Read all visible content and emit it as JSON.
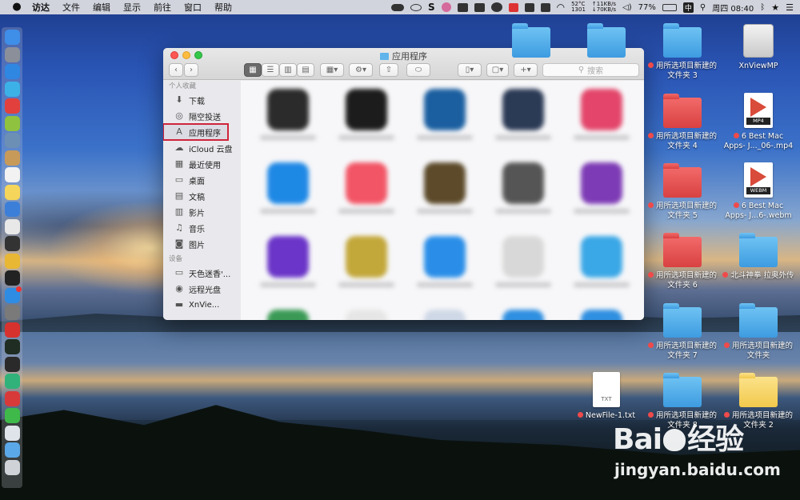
{
  "menubar": {
    "app_name": "访达",
    "items": [
      "文件",
      "编辑",
      "显示",
      "前往",
      "窗口",
      "帮助"
    ],
    "temperature": "52°C",
    "fan": "1301",
    "net_up": "↑11KB/s",
    "net_down": "↓70KB/s",
    "battery": "77%",
    "input_method": "中",
    "clock": "周四 08:40"
  },
  "finder": {
    "title": "应用程序",
    "search_placeholder": "搜索",
    "sidebar": {
      "favorites_header": "个人收藏",
      "favorites": [
        {
          "label": "下载",
          "icon": "download-icon",
          "glyph": "⬇"
        },
        {
          "label": "隔空投送",
          "icon": "airdrop-icon",
          "glyph": "◎"
        },
        {
          "label": "应用程序",
          "icon": "applications-icon",
          "glyph": "A"
        },
        {
          "label": "iCloud 云盘",
          "icon": "cloud-icon",
          "glyph": "☁"
        },
        {
          "label": "最近使用",
          "icon": "recents-icon",
          "glyph": "▦"
        },
        {
          "label": "桌面",
          "icon": "desktop-icon",
          "glyph": "▭"
        },
        {
          "label": "文稿",
          "icon": "documents-icon",
          "glyph": "▤"
        },
        {
          "label": "影片",
          "icon": "movies-icon",
          "glyph": "▥"
        },
        {
          "label": "音乐",
          "icon": "music-icon",
          "glyph": "♫"
        },
        {
          "label": "图片",
          "icon": "pictures-icon",
          "glyph": "◙"
        }
      ],
      "devices_header": "设备",
      "devices": [
        {
          "label": "天色迷香'...",
          "icon": "computer-icon",
          "glyph": "▭"
        },
        {
          "label": "远程光盘",
          "icon": "disc-icon",
          "glyph": "◉"
        },
        {
          "label": "XnVie...",
          "icon": "drive-icon",
          "glyph": "▬"
        }
      ]
    },
    "apps": [
      {
        "color": "#2b2b2b"
      },
      {
        "color": "#1c1c1c"
      },
      {
        "color": "#1b5fa0"
      },
      {
        "color": "#2b3a55"
      },
      {
        "color": "#e3466a"
      },
      {
        "color": "#1e88e5"
      },
      {
        "color": "#f25565"
      },
      {
        "color": "#5c4a2a"
      },
      {
        "color": "#555555"
      },
      {
        "color": "#7d3bb5"
      },
      {
        "color": "#6a35c8"
      },
      {
        "color": "#c2a73a"
      },
      {
        "color": "#2a8ee8"
      },
      {
        "color": "#d8d8d8"
      },
      {
        "color": "#3aa7e6"
      },
      {
        "color": "#3a9a55"
      },
      {
        "color": "#e6e6e6"
      },
      {
        "color": "#cfd8e6"
      },
      {
        "color": "#2f8fe0"
      },
      {
        "color": "#2f8fe0"
      }
    ]
  },
  "desktop": {
    "drive_label": "XnViewMP",
    "folder3": "用所选项目新建的文件夹 3",
    "mp4_label": "6 Best Mac Apps- J..._06-.mp4",
    "mp4_tag": "MP4",
    "folder4": "用所选项目新建的文件夹 4",
    "webm_label": "6 Best Mac Apps- J...6-.webm",
    "webm_tag": "WEBM",
    "folder5": "用所选项目新建的文件夹 5",
    "beidou": "北斗神拳 拉奥外传",
    "folder6": "用所选项目新建的文件夹 6",
    "folder7": "用所选项目新建的文件夹 7",
    "folder_plain": "用所选项目新建的文件夹",
    "txt_label": "NewFile-1.txt",
    "txt_tag": "TXT",
    "folder8": "用所选项目新建的文件夹 8",
    "folder2": "用所选项目新建的文件夹 2"
  },
  "watermark": {
    "logo_left": "Bai",
    "logo_right": "经验",
    "url": "jingyan.baidu.com"
  },
  "colors": {
    "selection_outline": "#d0243a",
    "tag_dot": "#ef4a4a",
    "folder_blue": "#3d9be0",
    "folder_red": "#d94141"
  },
  "dock": [
    {
      "name": "finder-dock-icon",
      "color": "#3f8ee8"
    },
    {
      "name": "launchpad-dock-icon",
      "color": "#8a8f99"
    },
    {
      "name": "safari-dock-icon",
      "color": "#2f87e2"
    },
    {
      "name": "maps-dock-icon",
      "color": "#3cb1e8"
    },
    {
      "name": "app-red-dock-icon",
      "color": "#e2403c"
    },
    {
      "name": "android-dock-icon",
      "color": "#8fc23f"
    },
    {
      "name": "preview-dock-icon",
      "color": "#6c8fb5"
    },
    {
      "name": "box-dock-icon",
      "color": "#c89a5a"
    },
    {
      "name": "calendar-dock-icon",
      "color": "#f2f2f2"
    },
    {
      "name": "notes-dock-icon",
      "color": "#f6d65a"
    },
    {
      "name": "contacts-dock-icon",
      "color": "#3c7fd8"
    },
    {
      "name": "files-dock-icon",
      "color": "#e8e8e8"
    },
    {
      "name": "camera-dock-icon",
      "color": "#333333"
    },
    {
      "name": "chrome-dock-icon",
      "color": "#e8b733"
    },
    {
      "name": "terminal-dock-icon",
      "color": "#222222"
    },
    {
      "name": "appstore-dock-icon",
      "color": "#2f8ce3"
    },
    {
      "name": "utility-dock-icon",
      "color": "#7a7a7a"
    },
    {
      "name": "vivaldi-dock-icon",
      "color": "#d8322e"
    },
    {
      "name": "monitor-dock-icon",
      "color": "#1f2d22"
    },
    {
      "name": "console-dock-icon",
      "color": "#2a2a2a"
    },
    {
      "name": "sync-dock-icon",
      "color": "#30b27a"
    },
    {
      "name": "netease-dock-icon",
      "color": "#d83a3a"
    },
    {
      "name": "wechat-dock-icon",
      "color": "#3eb94a"
    },
    {
      "name": "iphone-dock-icon",
      "color": "#dfe3ea"
    },
    {
      "name": "downloads-folder-dock-icon",
      "color": "#5aa8e8"
    },
    {
      "name": "trash-dock-icon",
      "color": "#cfd3d8"
    }
  ]
}
